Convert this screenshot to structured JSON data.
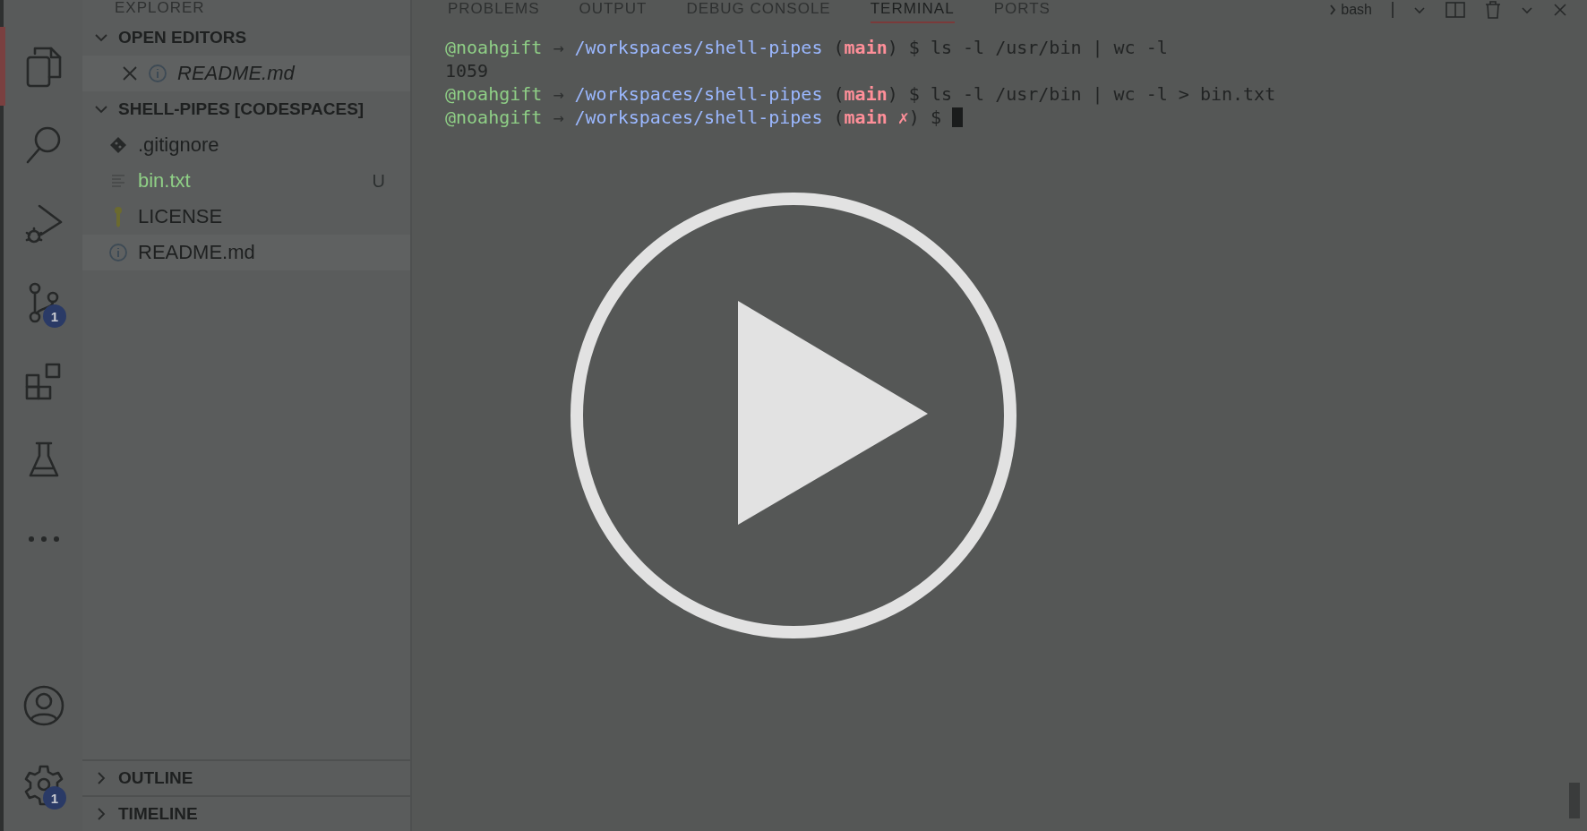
{
  "activity_bar": {
    "items": [
      {
        "kind": "files",
        "selected": true
      },
      {
        "kind": "search",
        "selected": false
      },
      {
        "kind": "run-debug",
        "selected": false
      },
      {
        "kind": "source-control",
        "selected": false,
        "badge": "1"
      },
      {
        "kind": "extensions",
        "selected": false
      },
      {
        "kind": "testing",
        "selected": false
      },
      {
        "kind": "more",
        "selected": false
      }
    ],
    "bottom": [
      {
        "kind": "account"
      },
      {
        "kind": "settings",
        "badge": "1"
      }
    ]
  },
  "sidebar": {
    "title": "EXPLORER",
    "open_editors": {
      "title": "OPEN EDITORS",
      "expanded": true,
      "items": [
        {
          "name": "README.md",
          "kind": "info",
          "selected": true
        }
      ]
    },
    "folder": {
      "title": "SHELL-PIPES [CODESPACES]",
      "expanded": true,
      "items": [
        {
          "name": ".gitignore",
          "kind": "git",
          "selected": false
        },
        {
          "name": "bin.txt",
          "kind": "text",
          "selected": false,
          "decoration": "U",
          "color": "#8fcf86"
        },
        {
          "name": "LICENSE",
          "kind": "license",
          "selected": false
        },
        {
          "name": "README.md",
          "kind": "info",
          "selected": true
        }
      ]
    },
    "collapsed_sections": [
      {
        "title": "OUTLINE",
        "expanded": false
      },
      {
        "title": "TIMELINE",
        "expanded": false
      }
    ]
  },
  "panel": {
    "tabs": [
      {
        "label": "PROBLEMS",
        "selected": false
      },
      {
        "label": "OUTPUT",
        "selected": false
      },
      {
        "label": "DEBUG CONSOLE",
        "selected": false
      },
      {
        "label": "TERMINAL",
        "selected": true
      },
      {
        "label": "PORTS",
        "selected": false
      }
    ],
    "terminal_name": "bash",
    "terminal": {
      "lines": [
        [
          {
            "kind": "user",
            "text": "@noahgift"
          },
          {
            "kind": "arrow",
            "text": "→"
          },
          {
            "kind": "path",
            "text": "/workspaces/shell-pipes"
          },
          {
            "kind": "plain",
            "text": "("
          },
          {
            "kind": "branch",
            "text": "main"
          },
          {
            "kind": "plain",
            "text": ") $ ls -l /usr/bin | wc -l"
          }
        ],
        [
          {
            "kind": "plain",
            "text": "1059"
          }
        ],
        [
          {
            "kind": "user",
            "text": "@noahgift"
          },
          {
            "kind": "arrow",
            "text": "→"
          },
          {
            "kind": "path",
            "text": "/workspaces/shell-pipes"
          },
          {
            "kind": "plain",
            "text": "("
          },
          {
            "kind": "branch",
            "text": "main"
          },
          {
            "kind": "plain",
            "text": ") $ ls -l /usr/bin | wc -l > bin.txt"
          }
        ],
        [
          {
            "kind": "user",
            "text": "@noahgift"
          },
          {
            "kind": "arrow",
            "text": "→"
          },
          {
            "kind": "path",
            "text": "/workspaces/shell-pipes"
          },
          {
            "kind": "plain",
            "text": "("
          },
          {
            "kind": "branch",
            "text": "main ✗"
          },
          {
            "kind": "plain",
            "text": ") $"
          },
          {
            "kind": "cursor"
          }
        ]
      ]
    }
  },
  "video": {
    "play_button": true
  }
}
